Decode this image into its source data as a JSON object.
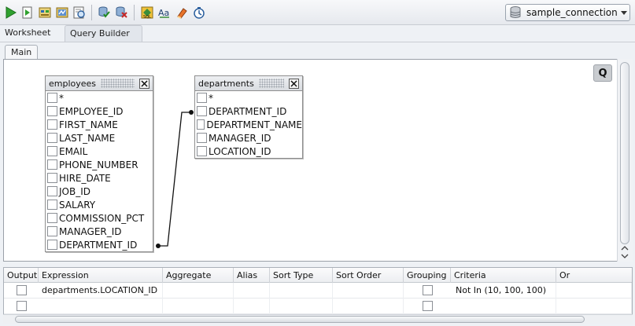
{
  "toolbar": {
    "icons": [
      "run-statement-icon",
      "run-script-icon",
      "explain-plan-icon",
      "autotrace-icon",
      "sql-tuning-advisor-icon",
      "commit-icon",
      "rollback-icon",
      "unshared-sql-icon",
      "to-uppercase-icon",
      "clear-icon",
      "sql-history-icon"
    ],
    "connection": {
      "label": "sample_connection",
      "icon": "database-icon"
    }
  },
  "tabs": [
    {
      "label": "Worksheet",
      "active": false
    },
    {
      "label": "Query Builder",
      "active": true
    }
  ],
  "subtabs": [
    {
      "label": "Main"
    }
  ],
  "canvas": {
    "q_button": "Q",
    "entities": [
      {
        "name": "employees",
        "columns": [
          "*",
          "EMPLOYEE_ID",
          "FIRST_NAME",
          "LAST_NAME",
          "EMAIL",
          "PHONE_NUMBER",
          "HIRE_DATE",
          "JOB_ID",
          "SALARY",
          "COMMISSION_PCT",
          "MANAGER_ID",
          "DEPARTMENT_ID"
        ]
      },
      {
        "name": "departments",
        "columns": [
          "*",
          "DEPARTMENT_ID",
          "DEPARTMENT_NAME",
          "MANAGER_ID",
          "LOCATION_ID"
        ]
      }
    ],
    "join": {
      "from": "employees.DEPARTMENT_ID",
      "to": "departments.DEPARTMENT_ID"
    }
  },
  "grid": {
    "headers": [
      "Output",
      "Expression",
      "Aggregate",
      "Alias",
      "Sort Type",
      "Sort Order",
      "Grouping",
      "Criteria",
      "Or"
    ],
    "rows": [
      {
        "output": false,
        "expression": "departments.LOCATION_ID",
        "aggregate": "",
        "alias": "",
        "sort_type": "",
        "sort_order": "",
        "grouping": false,
        "criteria": "Not In (10, 100, 100)",
        "or": ""
      },
      {
        "output": false,
        "expression": "",
        "aggregate": "",
        "alias": "",
        "sort_type": "",
        "sort_order": "",
        "grouping": false,
        "criteria": "",
        "or": ""
      }
    ]
  }
}
